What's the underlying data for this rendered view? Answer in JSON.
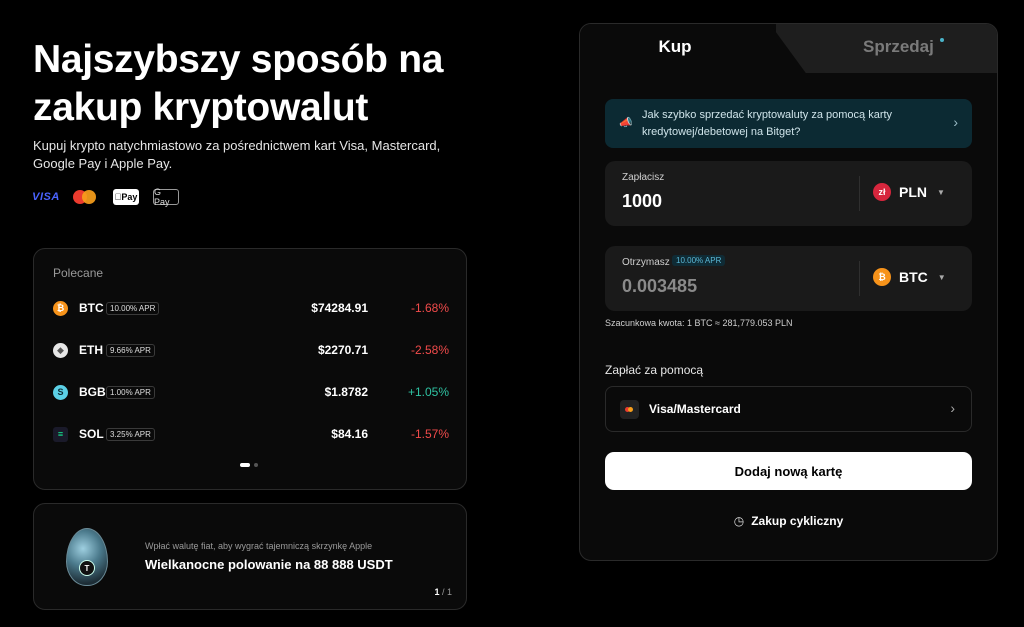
{
  "hero": {
    "title": "Najszybszy sposób na zakup kryptowalut",
    "subtitle": "Kupuj krypto natychmiastowo za pośrednictwem kart Visa, Mastercard, Google Pay i Apple Pay.",
    "payment_logos": [
      "VISA",
      "Mastercard",
      "Pay",
      "G Pay"
    ]
  },
  "featured": {
    "title": "Polecane",
    "coins": [
      {
        "symbol": "BTC",
        "apr": "10.00% APR",
        "price": "$74284.91",
        "change": "-1.68%",
        "trend": "negative",
        "icon_color": "#f7931a",
        "icon": "bitcoin-icon"
      },
      {
        "symbol": "ETH",
        "apr": "9.66% APR",
        "price": "$2270.71",
        "change": "-2.58%",
        "trend": "negative",
        "icon_color": "#e6e6e6",
        "icon": "ethereum-icon"
      },
      {
        "symbol": "BGB",
        "apr": "1.00% APR",
        "price": "$1.8782",
        "change": "+1.05%",
        "trend": "positive",
        "icon_color": "#5bd0e6",
        "icon": "bitget-icon"
      },
      {
        "symbol": "SOL",
        "apr": "3.25% APR",
        "price": "$84.16",
        "change": "-1.57%",
        "trend": "negative",
        "icon_color": "#14f195",
        "icon": "solana-icon"
      }
    ]
  },
  "promo": {
    "subtitle": "Wpłać walutę fiat, aby wygrać tajemniczą skrzynkę Apple",
    "title": "Wielkanocne polowanie na 88 888 USDT",
    "page_current": "1",
    "page_total": "/ 1"
  },
  "trade": {
    "tab_buy": "Kup",
    "tab_sell": "Sprzedaj",
    "info_banner": "Jak szybko sprzedać kryptowaluty za pomocą karty kredytowej/debetowej na Bitget?",
    "pay": {
      "label": "Zapłacisz",
      "value": "1000",
      "currency": "PLN",
      "currency_symbol": "zł",
      "currency_color": "#d7263d"
    },
    "receive": {
      "label": "Otrzymasz",
      "apr": "10.00% APR",
      "value": "0.003485",
      "currency": "BTC",
      "currency_symbol": "₿",
      "currency_color": "#f7931a"
    },
    "estimate": "Szacunkowa kwota: 1 BTC ≈ 281,779.053 PLN",
    "pay_with_label": "Zapłać za pomocą",
    "method": "Visa/Mastercard",
    "add_card": "Dodaj nową kartę",
    "recurring": "Zakup cykliczny"
  }
}
